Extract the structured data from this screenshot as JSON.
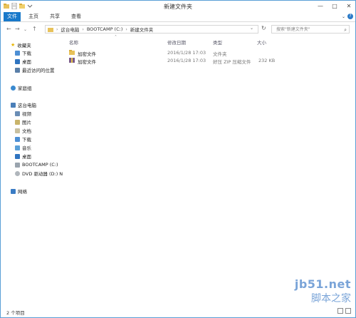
{
  "window": {
    "title": "新建文件夹",
    "controls": [
      "—",
      "□",
      "✕"
    ]
  },
  "ribbon": {
    "tabs": [
      "文件",
      "主页",
      "共享",
      "查看"
    ],
    "toggle_glyph": "⌄",
    "help_glyph": "?"
  },
  "address": {
    "path": [
      "这台电脑",
      "BOOTCAMP (C:)",
      "新建文件夹"
    ],
    "separator": "›",
    "search_placeholder": "搜索\"新建文件夹\""
  },
  "nav": {
    "favorites": {
      "label": "收藏夹",
      "items": [
        "下载",
        "桌面",
        "最近访问的位置"
      ]
    },
    "homegroup": "家庭组",
    "this_pc": {
      "label": "这台电脑",
      "items": [
        "视频",
        "图片",
        "文档",
        "下载",
        "音乐",
        "桌面",
        "BOOTCAMP (C:)",
        "DVD 驱动器 (D:) N"
      ]
    },
    "network": "网络"
  },
  "columns": [
    "名称",
    "修改日期",
    "类型",
    "大小"
  ],
  "files": [
    {
      "name": "加密文件",
      "date": "2016/1/28 17:03",
      "type": "文件夹",
      "size": ""
    },
    {
      "name": "加密文件",
      "date": "2016/1/28 17:03",
      "type": "好压 ZIP 压缩文件",
      "size": "232 KB"
    }
  ],
  "status": {
    "count": "2 个项目"
  },
  "watermark": {
    "site": "jb51.net",
    "cn": "脚本之家"
  },
  "colors": {
    "accent": "#1979ca",
    "folder": "#e8c25a",
    "watermark": "#7aa4d8"
  }
}
